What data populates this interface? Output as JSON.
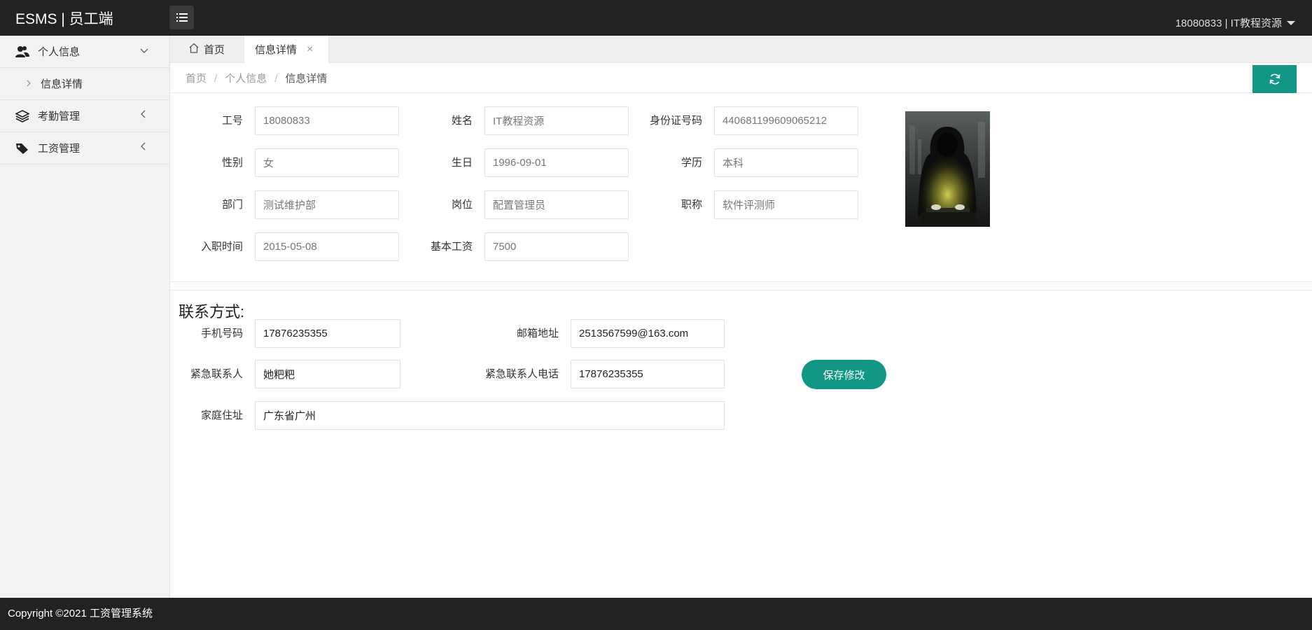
{
  "header": {
    "logo": "ESMS | 员工端",
    "user": "18080833 | IT教程资源"
  },
  "sidebar": {
    "items": [
      {
        "label": "个人信息",
        "icon": "users-icon",
        "expanded": true,
        "children": [
          {
            "label": "信息详情"
          }
        ]
      },
      {
        "label": "考勤管理",
        "icon": "layers-icon",
        "expanded": false
      },
      {
        "label": "工资管理",
        "icon": "tag-icon",
        "expanded": false
      }
    ]
  },
  "tabs": [
    {
      "label": "首页",
      "icon": "home-icon"
    },
    {
      "label": "信息详情",
      "active": true
    }
  ],
  "breadcrumb": [
    "首页",
    "个人信息",
    "信息详情"
  ],
  "profile": {
    "employee_id": {
      "label": "工号",
      "value": "18080833"
    },
    "name": {
      "label": "姓名",
      "value": "IT教程资源"
    },
    "id_number": {
      "label": "身份证号码",
      "value": "440681199609065212"
    },
    "gender": {
      "label": "性别",
      "value": "女"
    },
    "birthday": {
      "label": "生日",
      "value": "1996-09-01"
    },
    "education": {
      "label": "学历",
      "value": "本科"
    },
    "department": {
      "label": "部门",
      "value": "测试维护部"
    },
    "position": {
      "label": "岗位",
      "value": "配置管理员"
    },
    "title": {
      "label": "职称",
      "value": "软件评测师"
    },
    "hire_date": {
      "label": "入职时间",
      "value": "2015-05-08"
    },
    "base_salary": {
      "label": "基本工资",
      "value": "7500"
    }
  },
  "contact": {
    "section_title": "联系方式:",
    "phone": {
      "label": "手机号码",
      "value": "17876235355"
    },
    "email": {
      "label": "邮箱地址",
      "value": "2513567599@163.com"
    },
    "emergency_contact": {
      "label": "紧急联系人",
      "value": "她粑粑"
    },
    "emergency_phone": {
      "label": "紧急联系人电话",
      "value": "17876235355"
    },
    "address": {
      "label": "家庭住址",
      "value": "广东省广州"
    },
    "save_label": "保存修改"
  },
  "footer": {
    "text": "Copyright ©2021 工资管理系统"
  },
  "colors": {
    "header_bg": "#222222",
    "accent": "#129787",
    "sidebar_bg": "#f2f2f2"
  }
}
